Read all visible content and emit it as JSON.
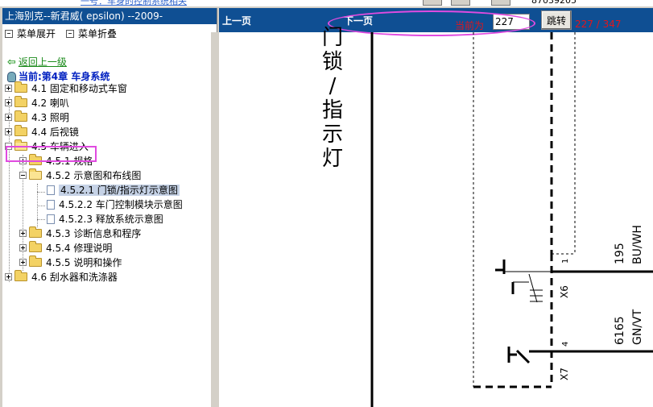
{
  "top_strip": {
    "cut_text": "一号：车身的控制系统相关",
    "number": "87039205"
  },
  "left_panel": {
    "title": "上海别克--新君威( epsilon) --2009-",
    "expand_label": "菜单展开",
    "collapse_label": "菜单折叠",
    "back_label": "返回上一级",
    "current_label": "当前:第4章  车身系统",
    "tree": [
      {
        "label": "4.1 固定和移动式车窗"
      },
      {
        "label": "4.2 喇叭"
      },
      {
        "label": "4.3 照明"
      },
      {
        "label": "4.4 后视镜"
      },
      {
        "label": "4.5 车辆进入"
      },
      {
        "label": "4.5.1 规格"
      },
      {
        "label": "4.5.2 示意图和布线图"
      },
      {
        "label": "4.5.2.1 门锁/指示灯示意图"
      },
      {
        "label": "4.5.2.2 车门控制模块示意图"
      },
      {
        "label": "4.5.2.3 释放系统示意图"
      },
      {
        "label": "4.5.3 诊断信息和程序"
      },
      {
        "label": "4.5.4 修理说明"
      },
      {
        "label": "4.5.5 说明和操作"
      },
      {
        "label": "4.6 刮水器和洗涤器"
      }
    ]
  },
  "toolbar": {
    "prev_label": "上一页",
    "next_label": "下一页",
    "current_page_label": "当前为",
    "page_value": "227",
    "jump_label": "跳转",
    "page_count": "227 / 347"
  },
  "diagram": {
    "title_chars": [
      "门",
      "锁",
      "/",
      "指",
      "示",
      "灯"
    ],
    "labels": [
      "195",
      "BU/WH",
      "6165",
      "GN/VT",
      "1",
      "X6",
      "4",
      "X7"
    ]
  },
  "colors": {
    "header_blue": "#0f4f93",
    "highlight": "#e04be0",
    "accent_red": "#e0161c"
  }
}
